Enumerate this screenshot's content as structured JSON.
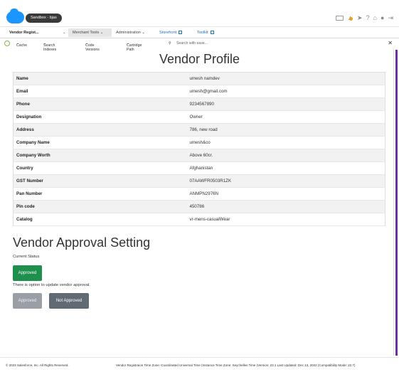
{
  "header": {
    "sandbox_label": "Sandbox - bjas"
  },
  "nav": {
    "vendor_tab": "Vendor Regist...",
    "merchant_tools": "Merchant Tools",
    "administration": "Administration",
    "storefront": "Storefront",
    "toolkit": "Toolkit"
  },
  "toolbar": {
    "cache": "Cache",
    "search_indexes": "Search Indexes",
    "code_versions": "Code Versions",
    "cartridge_path": "Cartridge Path",
    "search_placeholder": "Search with ease..."
  },
  "page": {
    "title": "Vendor Profile",
    "rows": [
      {
        "label": "Name",
        "value": "umesh namdev"
      },
      {
        "label": "Email",
        "value": "umesh@gmail.com"
      },
      {
        "label": "Phone",
        "value": "9234567890"
      },
      {
        "label": "Designation",
        "value": "Owner"
      },
      {
        "label": "Address",
        "value": "786, new road"
      },
      {
        "label": "Company Name",
        "value": "umesh&co"
      },
      {
        "label": "Company Worth",
        "value": "Above 60cr."
      },
      {
        "label": "Country",
        "value": "Afghanistan"
      },
      {
        "label": "GST Number",
        "value": "07AAWFR0503R1ZK"
      },
      {
        "label": "Pan Number",
        "value": "ANMPN2976N"
      },
      {
        "label": "Pin code",
        "value": "450786"
      },
      {
        "label": "Catalog",
        "value": "vr-mens-casualWear"
      }
    ]
  },
  "approval": {
    "title": "Vendor Approval Setting",
    "current_status_label": "Current Status",
    "current_status": "Approved",
    "option_text": "There is option to update vendor approval.",
    "approved_button": "Approved",
    "not_approved_button": "Not Approved"
  },
  "footer": {
    "copyright": "© 2023 Salesforce, Inc. All Rights Reserved.",
    "info": "Vendor Registraion Time Zone: Coordinated Universal Time (Instance Time Zone: Seychelles Time (Version: 23.1 Last Updated: Dec 13, 2022 (Compatibility Mode: 22.7)"
  }
}
